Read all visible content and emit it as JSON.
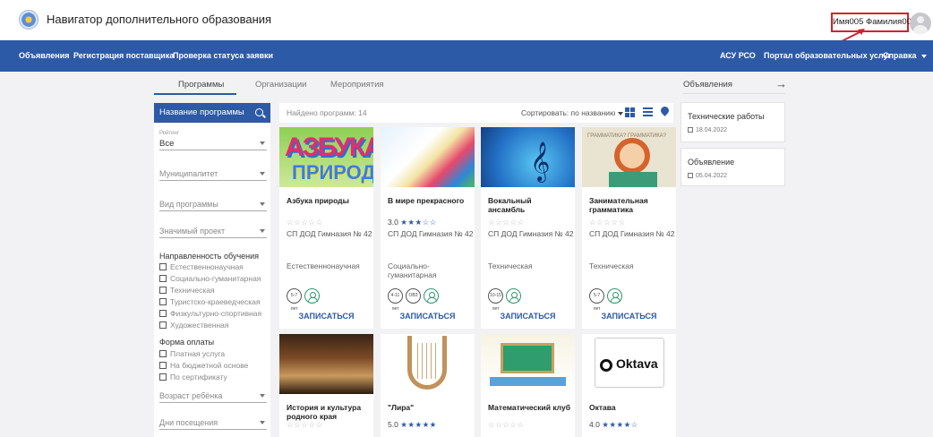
{
  "header": {
    "title": "Навигатор дополнительного образования",
    "user_name": "Имя005 Фамилия005"
  },
  "nav": {
    "left": [
      "Объявления",
      "Регистрация поставщика",
      "Проверка статуса заявки"
    ],
    "right": [
      "АСУ РСО",
      "Портал образовательных услуг",
      "Справка"
    ]
  },
  "tabs": [
    "Программы",
    "Организации",
    "Мероприятия"
  ],
  "filters": {
    "search_label": "Название программы",
    "rating_label": "Рейтинг",
    "rating_value": "Все",
    "municipality": "Муниципалитет",
    "program_type": "Вид программы",
    "significant_project": "Значимый проект",
    "direction_title": "Направленность обучения",
    "directions": [
      "Естественнонаучная",
      "Социально-гуманитарная",
      "Техническая",
      "Туристско-краеведческая",
      "Физкультурно-спортивная",
      "Художественная"
    ],
    "payment_title": "Форма оплаты",
    "payments": [
      "Платная услуга",
      "На бюджетной основе",
      "По сертификату"
    ],
    "child_age": "Возраст ребёнка",
    "visit_days": "Дни посещения"
  },
  "results": {
    "found": "Найдено программ: 14",
    "sort": "Сортировать: по названию"
  },
  "cards": [
    {
      "title": "Азбука природы",
      "rating": "",
      "stars": "☆☆☆☆☆",
      "org": "СП ДОД Гимназия № 42",
      "direction": "Естественнонаучная",
      "badges": [
        "5-7 лет"
      ],
      "enroll": "ЗАПИСАТЬСЯ",
      "image_text_1": "АЗБУКА",
      "image_text_2": "ПРИРОДЫ"
    },
    {
      "title": "В мире прекрасного",
      "rating": "3.0",
      "stars": "★★★☆☆",
      "org": "СП ДОД Гимназия № 42",
      "direction": "Социально-гуманитарная",
      "badges": [
        "4-11 лет",
        "ОВЗ"
      ],
      "enroll": "ЗАПИСАТЬСЯ"
    },
    {
      "title": "Вокальный ансамбль",
      "rating": "",
      "stars": "☆☆☆☆☆",
      "org": "СП ДОД Гимназия № 42",
      "direction": "Техническая",
      "badges": [
        "10-15 лет"
      ],
      "enroll": "ЗАПИСАТЬСЯ"
    },
    {
      "title": "Занимательная грамматика",
      "rating": "",
      "stars": "☆☆☆☆☆",
      "org": "СП ДОД Гимназия № 42",
      "direction": "Техническая",
      "badges": [
        "5-7 лет"
      ],
      "enroll": "ЗАПИСАТЬСЯ",
      "image_text": "ГРАММАТИКА? ГРАММАТИКА?"
    },
    {
      "title": "История и культура родного края",
      "rating": "",
      "stars": "☆☆☆☆☆"
    },
    {
      "title": "\"Лира\"",
      "rating": "5.0",
      "stars": "★★★★★"
    },
    {
      "title": "Математический клуб",
      "rating": "",
      "stars": "☆☆☆☆☆"
    },
    {
      "title": "Октава",
      "rating": "4.0",
      "stars": "★★★★☆",
      "image_text": "Oktava"
    }
  ],
  "announcements": {
    "title": "Объявления",
    "items": [
      {
        "title": "Технические работы",
        "date": "18.04.2022"
      },
      {
        "title": "Объявление",
        "date": "05.04.2022"
      }
    ]
  },
  "colors": {
    "brand": "#2d5aa6",
    "highlight": "#d0232f",
    "person_badge": "#2d9a6e"
  }
}
